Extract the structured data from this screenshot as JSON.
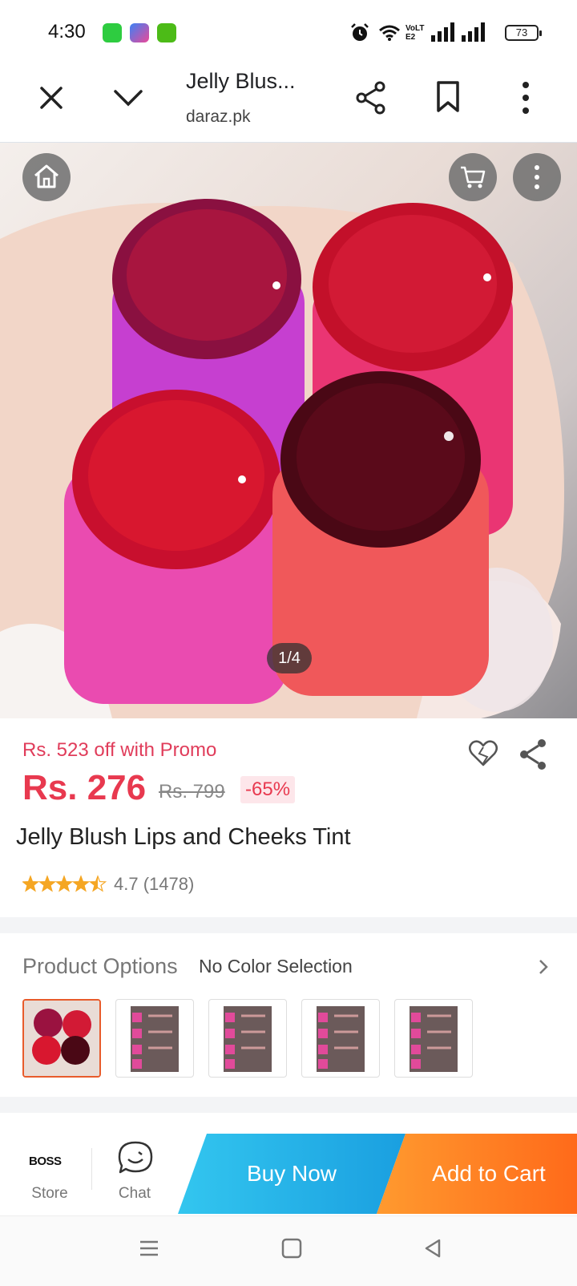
{
  "status_bar": {
    "time": "4:30",
    "battery": "73",
    "network_label": "VoLTE2",
    "icons": [
      "app-green-icon",
      "app-blue-icon",
      "app-lime-icon",
      "alarm-icon",
      "wifi-icon",
      "signal-icon",
      "signal-icon",
      "battery-icon"
    ]
  },
  "browser": {
    "page_title": "Jelly Blus...",
    "url": "daraz.pk"
  },
  "gallery": {
    "pager": "1/4"
  },
  "product": {
    "promo_text": "Rs. 523 off with Promo",
    "price": "Rs. 276",
    "original_price": "Rs. 799",
    "discount": "-65%",
    "title": "Jelly Blush Lips and Cheeks Tint",
    "rating_value": "4.7",
    "rating_count": "(1478)",
    "stars": 4.5
  },
  "options": {
    "label": "Product Options",
    "value": "No Color Selection",
    "thumbnail_count": 5
  },
  "actions": {
    "store_brand": "BOSS",
    "store_label": "Store",
    "chat_label": "Chat",
    "buy_now": "Buy Now",
    "add_to_cart": "Add to Cart"
  },
  "colors": {
    "price_red": "#e8394f",
    "buy_blue": "#1a9fe0",
    "cart_orange": "#ff6a1a"
  }
}
